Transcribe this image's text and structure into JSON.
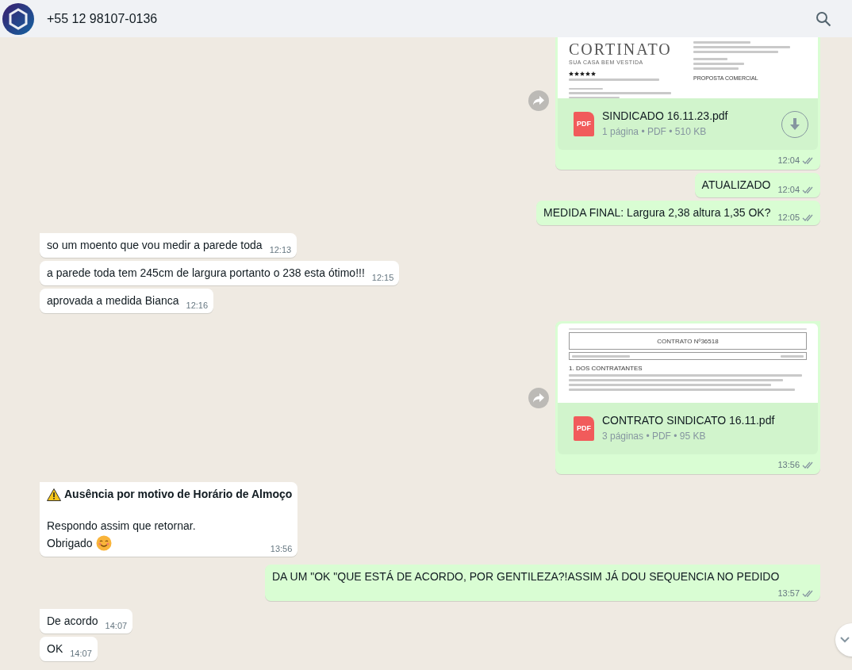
{
  "header": {
    "contact": "+55 12 98107-0136"
  },
  "messages": [
    {
      "kind": "document",
      "outgoing": true,
      "preview": {
        "kind": "proposal",
        "brand": "CORTINATO",
        "tagline": "SUA CASA BEM VESTIDA",
        "stars": 5,
        "heading": "PROPOSTA COMERCIAL"
      },
      "badge": "PDF",
      "file": "SINDICADO 16.11.23.pdf",
      "meta": "1 página • PDF • 510 KB",
      "download": true,
      "time": "12:04",
      "read": false
    },
    {
      "kind": "text",
      "outgoing": true,
      "text": "ATUALIZADO",
      "time": "12:04",
      "read": false
    },
    {
      "kind": "text",
      "outgoing": true,
      "text": "MEDIDA FINAL: Largura 2,38 altura 1,35 OK?",
      "time": "12:05",
      "read": false
    },
    {
      "kind": "text",
      "outgoing": false,
      "text": "so um moento que vou medir a parede toda",
      "time": "12:13"
    },
    {
      "kind": "text",
      "outgoing": false,
      "text": "a parede toda tem 245cm de largura portanto o 238 esta ótimo!!!",
      "time": "12:15"
    },
    {
      "kind": "text",
      "outgoing": false,
      "text": "aprovada a medida Bianca",
      "time": "12:16"
    },
    {
      "kind": "document",
      "outgoing": true,
      "preview": {
        "kind": "contract",
        "title": "CONTRATO Nº36518",
        "section": "1. DOS CONTRATANTES"
      },
      "badge": "PDF",
      "file": "CONTRATO SINDICATO 16.11.pdf",
      "meta": "3 páginas • PDF • 95 KB",
      "download": false,
      "time": "13:56",
      "read": false
    },
    {
      "kind": "notice",
      "outgoing": false,
      "title": "Ausência por motivo de Horário de Almoço",
      "lines": [
        {
          "text": "Respondo assim que retornar.",
          "emoji": false
        },
        {
          "text": "Obrigado",
          "emoji": true
        }
      ],
      "time": "13:56"
    },
    {
      "kind": "text",
      "outgoing": true,
      "text": "DA UM \"OK \"QUE ESTÁ DE ACORDO, POR GENTILEZA?!ASSIM JÁ DOU SEQUENCIA NO PEDIDO",
      "time": "13:57",
      "read": false
    },
    {
      "kind": "text",
      "outgoing": false,
      "text": "De acordo",
      "time": "14:07"
    },
    {
      "kind": "text",
      "outgoing": false,
      "text": "OK",
      "time": "14:07"
    }
  ]
}
